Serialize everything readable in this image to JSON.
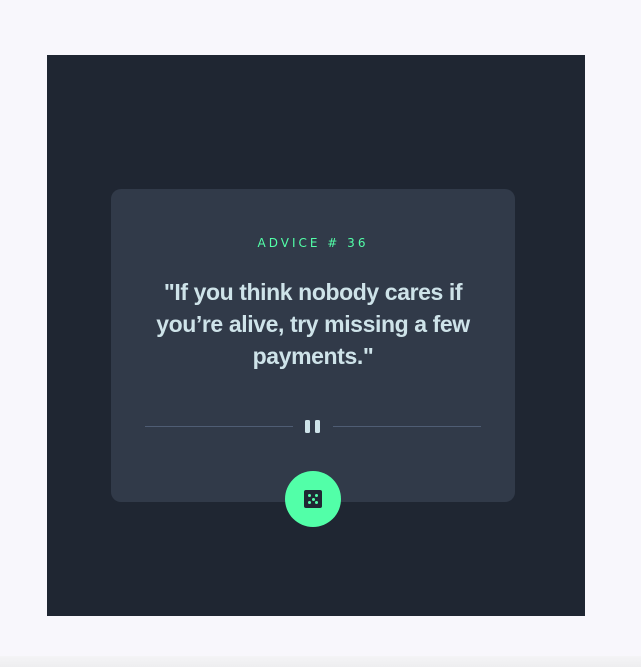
{
  "advice": {
    "label": "ADVICE # 36",
    "quote": "\"If you think nobody cares if you’re alive, try missing a few payments.\""
  },
  "icons": {
    "divider": "pause-icon",
    "button": "dice-icon"
  },
  "colors": {
    "page_background": "#f8f7fc",
    "frame_background": "#1f2632",
    "card_background": "#313a49",
    "accent": "#52ffa8",
    "text": "#cee3e9",
    "divider": "#4f5d74"
  }
}
